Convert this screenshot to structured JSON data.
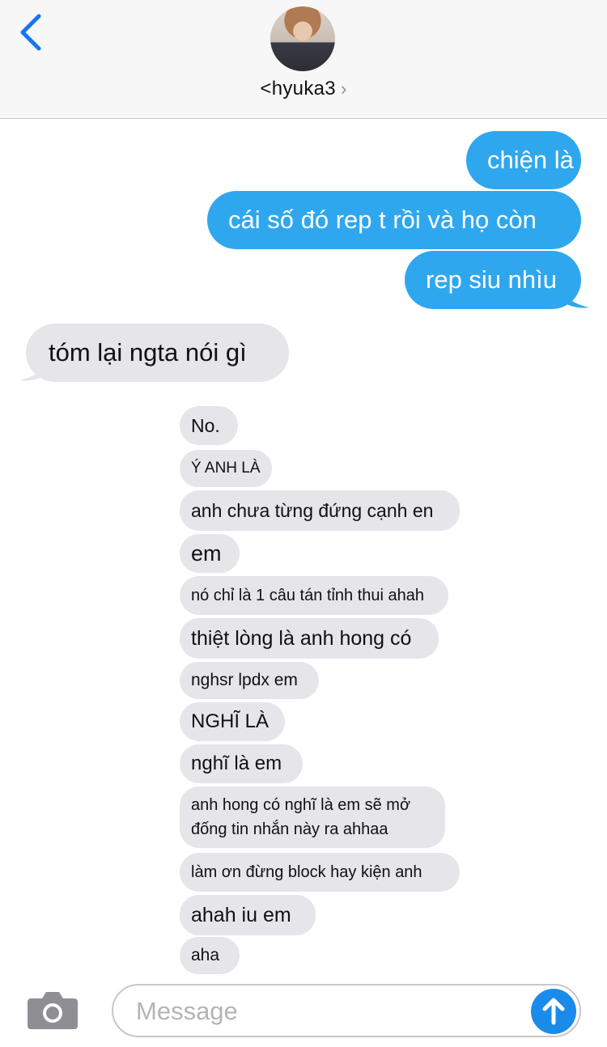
{
  "header": {
    "contact_name": "<hyuka3",
    "chevron": "›",
    "back_icon": "chevron-left-icon",
    "avatar": "contact-avatar-photo"
  },
  "messages": {
    "sent": [
      "chiện là",
      "cái số đó rep t rồi và họ còn",
      "rep siu nhìu"
    ],
    "received_big": "tóm lại ngta nói gì",
    "forwarded": [
      "No.",
      "Ý ANH LÀ",
      "anh chưa từng đứng cạnh en",
      "em",
      "nó chỉ là 1 câu tán tỉnh thui ahah",
      "thiệt lòng là anh hong có",
      "nghsr lpdx em",
      "NGHĨ LÀ",
      "nghĩ là em",
      "anh hong có nghĩ là em sẽ mở đống tin nhắn này ra ahhaa",
      "làm ơn đừng block hay kiện anh",
      "ahah iu em",
      "aha"
    ]
  },
  "input": {
    "placeholder": "Message",
    "camera_icon": "camera-icon",
    "send_icon": "arrow-up-icon"
  },
  "colors": {
    "sent_bubble": "#2fa7ee",
    "received_bubble": "#e5e5ea",
    "accent": "#1b8bea"
  }
}
